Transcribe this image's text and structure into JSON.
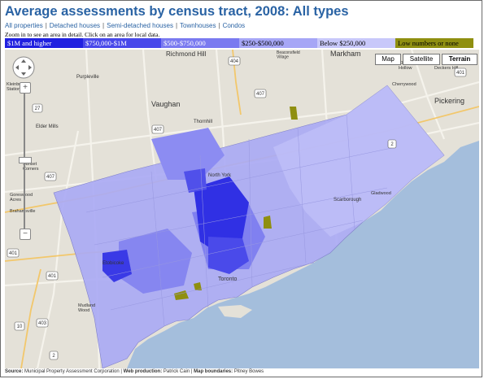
{
  "title": "Average assessments by census tract, 2008: All types",
  "nav_links": [
    "All properties",
    "Detached houses",
    "Semi-detached houses",
    "Townhouses",
    "Condos"
  ],
  "hint": "Zoom in to see an area in detail. Click on an area for local data.",
  "legend": [
    {
      "label": "$1M and higher",
      "color": "#2020e0",
      "text_color": "#ffffff"
    },
    {
      "label": "$750,000-$1M",
      "color": "#4848ea",
      "text_color": "#ffffff"
    },
    {
      "label": "$500-$750,000",
      "color": "#7a7af0",
      "text_color": "#ffffff"
    },
    {
      "label": "$250-$500,000",
      "color": "#a6a6f6",
      "text_color": "#000000"
    },
    {
      "label": "Below $250,000",
      "color": "#c8c8fa",
      "text_color": "#000000"
    },
    {
      "label": "Low numbers or none",
      "color": "#8f8f10",
      "text_color": "#000000"
    }
  ],
  "map_types": [
    {
      "label": "Map",
      "active": false
    },
    {
      "label": "Satellite",
      "active": false
    },
    {
      "label": "Terrain",
      "active": true
    }
  ],
  "place_labels": {
    "richmond_hill": "Richmond Hill",
    "markham": "Markham",
    "vaughan": "Vaughan",
    "pickering": "Pickering",
    "purpleville": "Purpleville",
    "thornhill": "Thornhill",
    "elder_mills": "Elder Mills",
    "goreswood": "Goreswood\nAcres",
    "brahamsville": "Brahamsville",
    "sunset": "Sunset\nCorners",
    "kleinburg": "Kleinburg\nStation",
    "toronto": "Toronto",
    "scarborough": "Scarborough",
    "north_york": "North York",
    "etobicoke": "Etobicoke",
    "mississauga_wood": "Mudland\nWood",
    "cherrywood": "Cherrywood",
    "clarkes_hollow": "Clarkes\nHollow",
    "deckers_hill": "Deckers Hill",
    "gladwood": "Gladwood",
    "beaconsfield": "Beaconsfield\nVillage"
  },
  "road_shields": [
    "404",
    "407",
    "407",
    "407",
    "401",
    "401",
    "401",
    "403",
    "2",
    "2",
    "27",
    "10"
  ],
  "footer": {
    "source_label": "Source:",
    "source": "Municipal Property Assessment Corporation",
    "web_label": "Web production:",
    "web": "Patrick Cain",
    "boundaries_label": "Map boundaries:",
    "boundaries": "Pitney Bowes"
  },
  "colors": {
    "title": "#2a63a4",
    "lake": "#a4bedc",
    "land": "#e4e1d8",
    "overlay_base": "#aaaaf4"
  }
}
